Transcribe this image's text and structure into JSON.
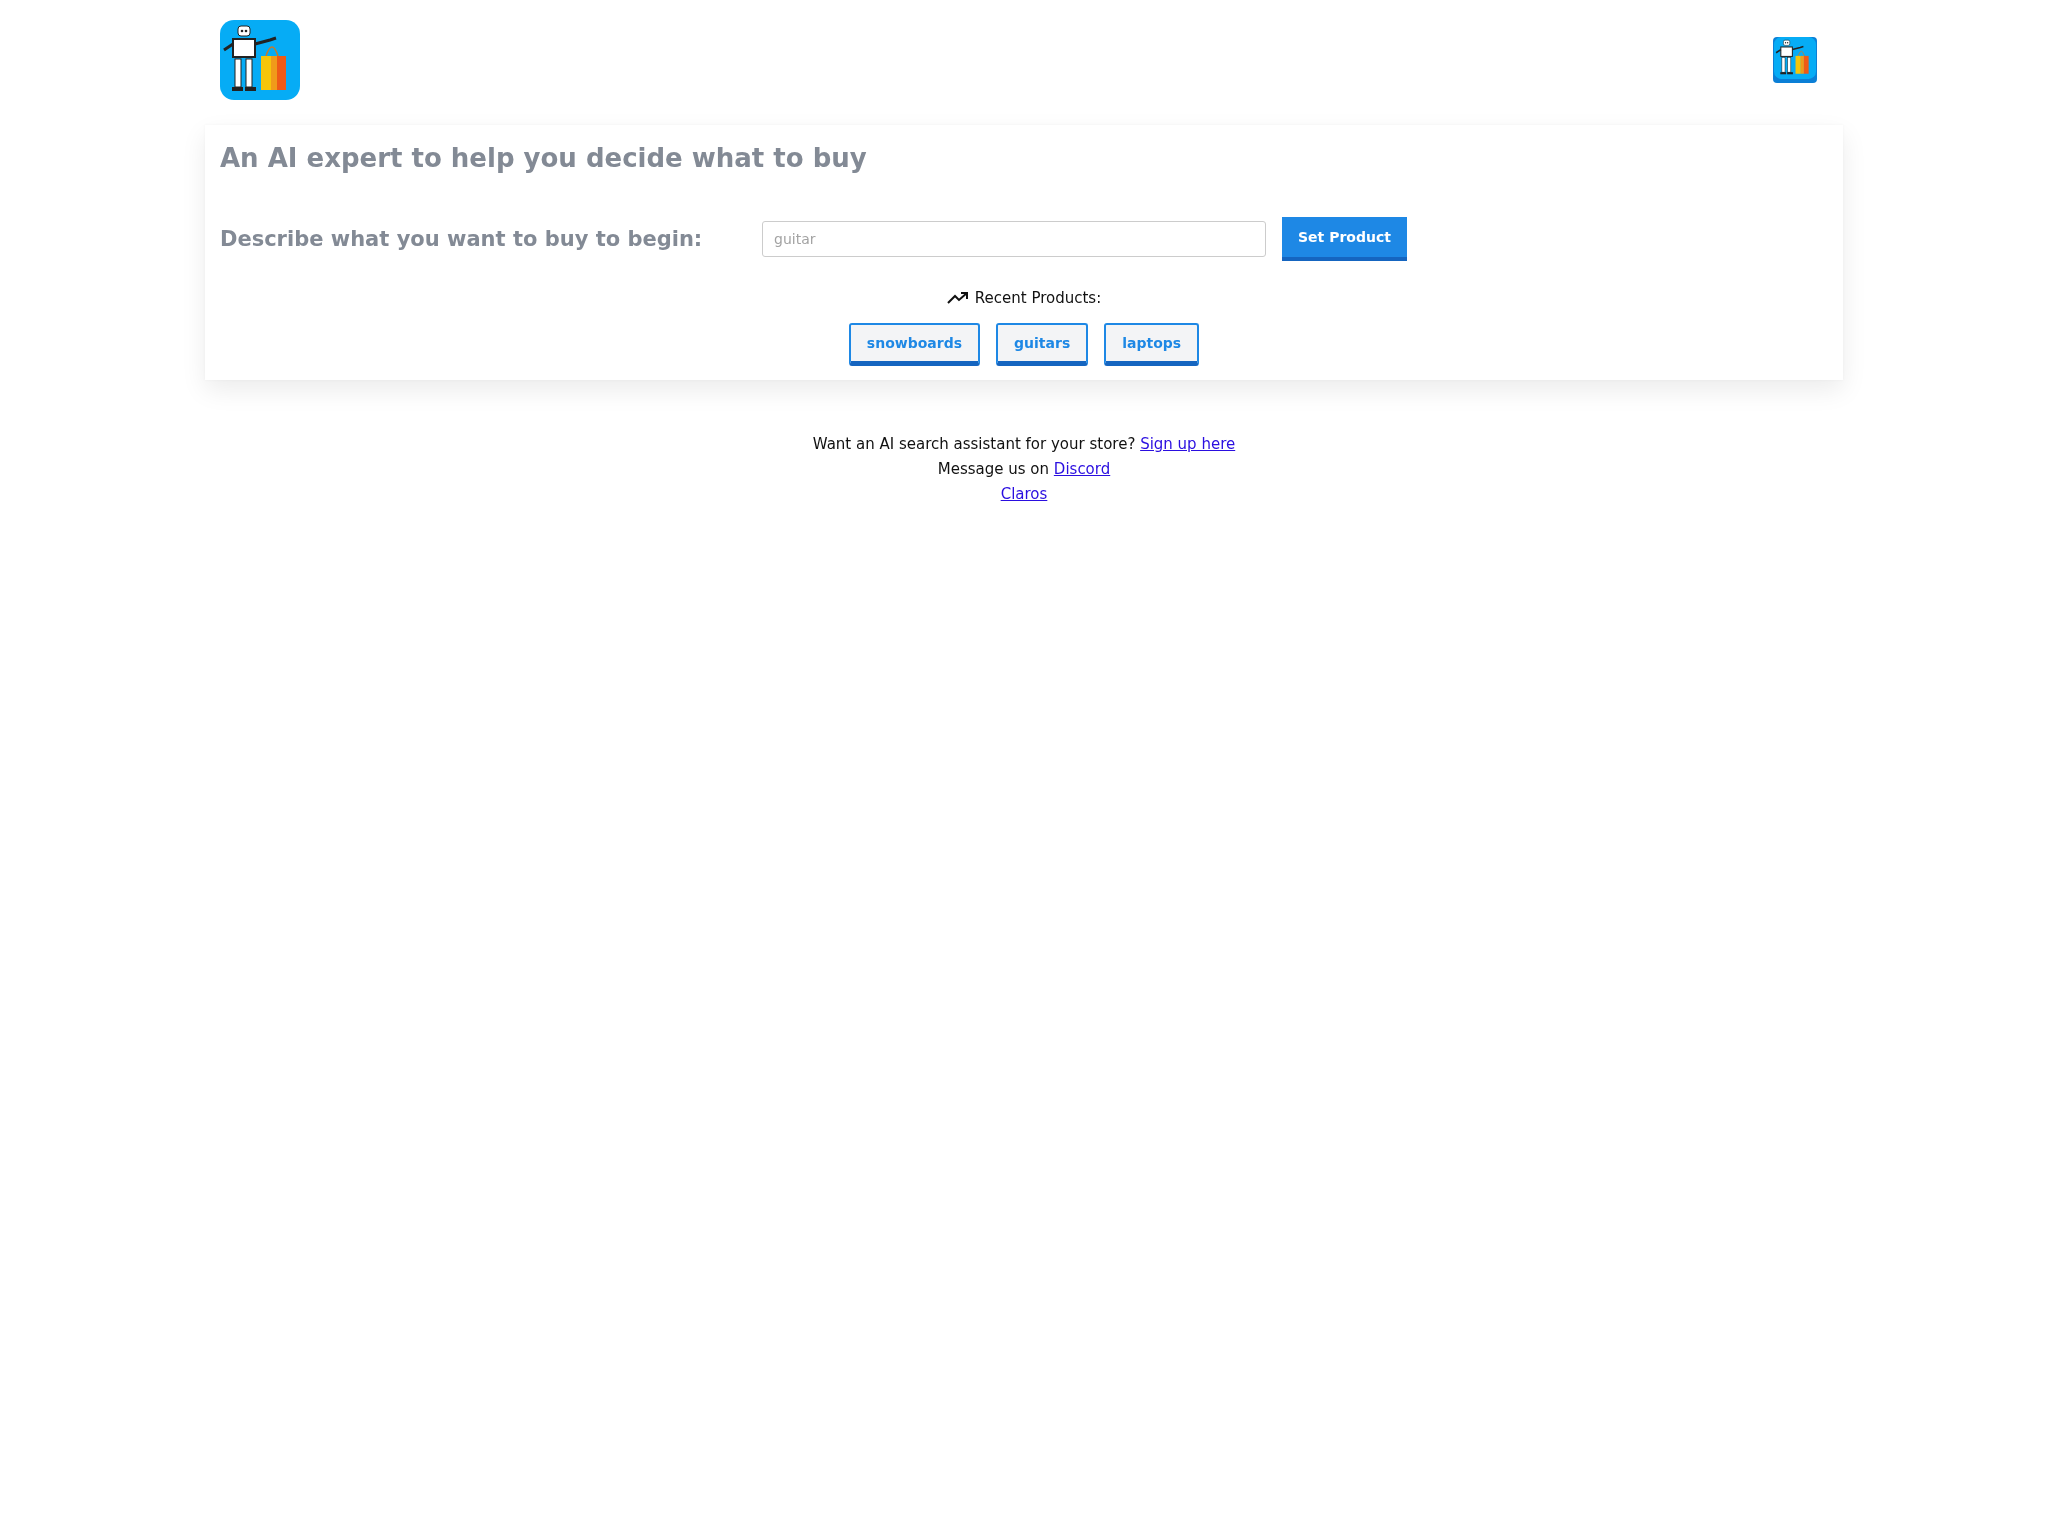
{
  "header": {
    "profile_button": {
      "kind": "logo"
    }
  },
  "hero": {
    "title": "An AI expert to help you decide what to buy",
    "prompt_label": "Describe what you want to buy to begin:",
    "product_input": {
      "placeholder": "guitar"
    },
    "submit_button": "Set Product",
    "recent_label": "Recent Products:",
    "recent_products": [
      "snowboards",
      "guitars",
      "laptops"
    ]
  },
  "footer": [
    {
      "text": "Want an AI search assistant for your store?",
      "link": "Sign up here"
    },
    {
      "text": "Message us on",
      "link": "Discord"
    },
    {
      "link": "Claros"
    }
  ]
}
